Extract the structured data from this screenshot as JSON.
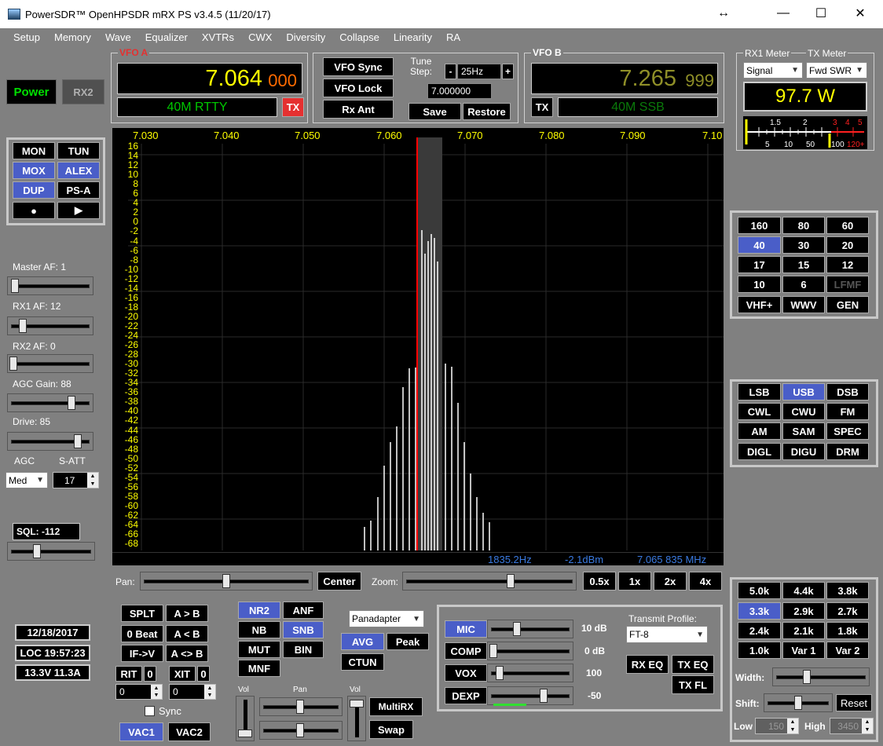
{
  "window": {
    "title": "PowerSDR™ OpenHPSDR mRX PS v3.4.5 (11/20/17)"
  },
  "menu": [
    "Setup",
    "Memory",
    "Wave",
    "Equalizer",
    "XVTRs",
    "CWX",
    "Diversity",
    "Collapse",
    "Linearity",
    "RA"
  ],
  "power": {
    "power_label": "Power",
    "rx2_label": "RX2"
  },
  "vfo_a": {
    "legend": "VFO A",
    "freq_main": "7.064",
    "freq_sub": "000",
    "band": "40M RTTY",
    "tx_label": "TX"
  },
  "vfo_b": {
    "legend": "VFO B",
    "freq_main": "7.265",
    "freq_sub": "999",
    "band": "40M SSB",
    "tx_label": "TX"
  },
  "vfo_mid": {
    "sync": "VFO Sync",
    "lock": "VFO Lock",
    "rxant": "Rx Ant",
    "tune_label": "Tune\nStep:",
    "tune_step": "25Hz",
    "minus": "-",
    "plus": "+",
    "freq": "7.000000",
    "save": "Save",
    "restore": "Restore"
  },
  "meters": {
    "rx1_label": "RX1 Meter",
    "tx_label": "TX Meter",
    "rx1_select": "Signal",
    "tx_select": "Fwd SWR",
    "value": "97.7 W",
    "scale_top": [
      "1.5",
      "2",
      "3",
      "4",
      "5"
    ],
    "scale_bottom": [
      "5",
      "10",
      "50",
      "100",
      "120+"
    ]
  },
  "control_buttons": {
    "mon": "MON",
    "tun": "TUN",
    "mox": "MOX",
    "alex": "ALEX",
    "dup": "DUP",
    "psa": "PS-A",
    "record": "●",
    "play": "▶"
  },
  "audio": {
    "master_af": "Master AF:  1",
    "rx1_af": "RX1 AF:  12",
    "rx2_af": "RX2 AF:  0",
    "agc_gain": "AGC Gain:  88",
    "drive": "Drive:  85",
    "agc": "AGC",
    "satt": "S-ATT",
    "agc_mode": "Med",
    "satt_value": "17",
    "sql": "SQL: -112"
  },
  "status": {
    "date": "12/18/2017",
    "loc": "LOC 19:57:23",
    "power": "13.3V 11.3A"
  },
  "display": {
    "freq_ticks": [
      "7.030",
      "7.040",
      "7.050",
      "7.060",
      "7.070",
      "7.080",
      "7.090",
      "7.10"
    ],
    "db_ticks": [
      "16",
      "14",
      "12",
      "10",
      "8",
      "6",
      "4",
      "2",
      "0",
      "-2",
      "-4",
      "-6",
      "-8",
      "-10",
      "-12",
      "-14",
      "-16",
      "-18",
      "-20",
      "-22",
      "-24",
      "-26",
      "-28",
      "-30",
      "-32",
      "-34",
      "-36",
      "-38",
      "-40",
      "-42",
      "-44",
      "-46",
      "-48",
      "-50",
      "-52",
      "-54",
      "-56",
      "-58",
      "-60",
      "-62",
      "-64",
      "-66",
      "-68"
    ],
    "cursor_hz": "1835.2Hz",
    "cursor_dbm": "-2.1dBm",
    "cursor_mhz": "7.065 835 MHz"
  },
  "pan": {
    "pan_label": "Pan:",
    "center": "Center",
    "zoom_label": "Zoom:",
    "z05": "0.5x",
    "z1": "1x",
    "z2": "2x",
    "z4": "4x"
  },
  "bands": [
    "160",
    "80",
    "60",
    "40",
    "30",
    "20",
    "17",
    "15",
    "12",
    "10",
    "6",
    "LFMF",
    "VHF+",
    "WWV",
    "GEN"
  ],
  "modes": [
    "LSB",
    "USB",
    "DSB",
    "CWL",
    "CWU",
    "FM",
    "AM",
    "SAM",
    "SPEC",
    "DIGL",
    "DIGU",
    "DRM"
  ],
  "filters": [
    "5.0k",
    "4.4k",
    "3.8k",
    "3.3k",
    "2.9k",
    "2.7k",
    "2.4k",
    "2.1k",
    "1.8k",
    "1.0k",
    "Var 1",
    "Var 2"
  ],
  "filter_ctrl": {
    "width": "Width:",
    "shift": "Shift:",
    "reset": "Reset",
    "low": "Low",
    "low_value": "150",
    "high": "High",
    "high_value": "3450"
  },
  "split": {
    "splt": "SPLT",
    "a_to_b": "A > B",
    "zero_beat": "0 Beat",
    "b_to_a": "A < B",
    "if_v": "IF->V",
    "swap_ab": "A <> B",
    "rit": "RIT",
    "rit_val": "0",
    "xit": "XIT",
    "xit_val": "0",
    "rit_spin": "0",
    "xit_spin": "0",
    "sync": "Sync",
    "vac1": "VAC1",
    "vac2": "VAC2"
  },
  "dsp": {
    "nr2": "NR2",
    "anf": "ANF",
    "nb": "NB",
    "snb": "SNB",
    "mut": "MUT",
    "bin": "BIN",
    "mnf": "MNF",
    "display_mode": "Panadapter",
    "avg": "AVG",
    "peak": "Peak",
    "ctun": "CTUN"
  },
  "mixer": {
    "vol1": "Vol",
    "pan": "Pan",
    "vol2": "Vol",
    "multirx": "MultiRX",
    "swap": "Swap"
  },
  "tx": {
    "mic": "MIC",
    "mic_val": "10 dB",
    "comp": "COMP",
    "comp_val": "0 dB",
    "vox": "VOX",
    "vox_val": "100",
    "dexp": "DEXP",
    "dexp_val": "-50",
    "profile_label": "Transmit Profile:",
    "profile": "FT-8",
    "rx_eq": "RX EQ",
    "tx_eq": "TX EQ",
    "tx_fl": "TX FL"
  },
  "colors": {
    "accent_blue": "#4a5ec8",
    "vfo_yellow": "#ffff00",
    "band_green": "#00c800",
    "tx_red": "#e53030",
    "axis_yellow": "#ffff00",
    "cursor_red": "#ff0000"
  }
}
